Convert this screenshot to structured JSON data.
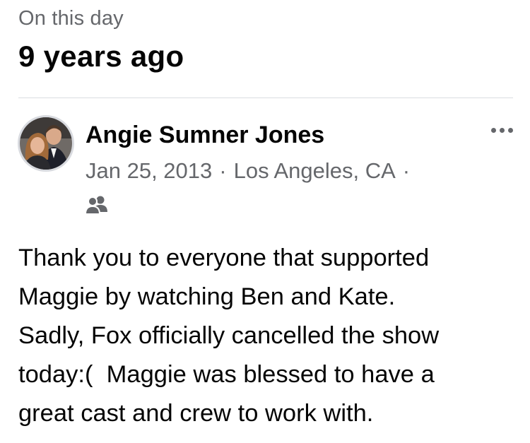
{
  "memories": {
    "label": "On this day",
    "title": "9 years ago"
  },
  "post": {
    "author": "Angie Sumner Jones",
    "date": "Jan 25, 2013",
    "separator": "·",
    "location": "Los Angeles, CA",
    "trailing_separator": "·",
    "audience_icon": "friends-icon",
    "more_icon": "more-options-icon",
    "body_lines": [
      "Thank you to everyone that supported",
      "Maggie by watching Ben and Kate.",
      "Sadly, Fox officially cancelled the show",
      "today:(  Maggie was blessed to have a",
      "great cast and crew to work with."
    ]
  },
  "colors": {
    "primary_text": "#050505",
    "secondary_text": "#65676b",
    "divider": "#dadde1"
  }
}
